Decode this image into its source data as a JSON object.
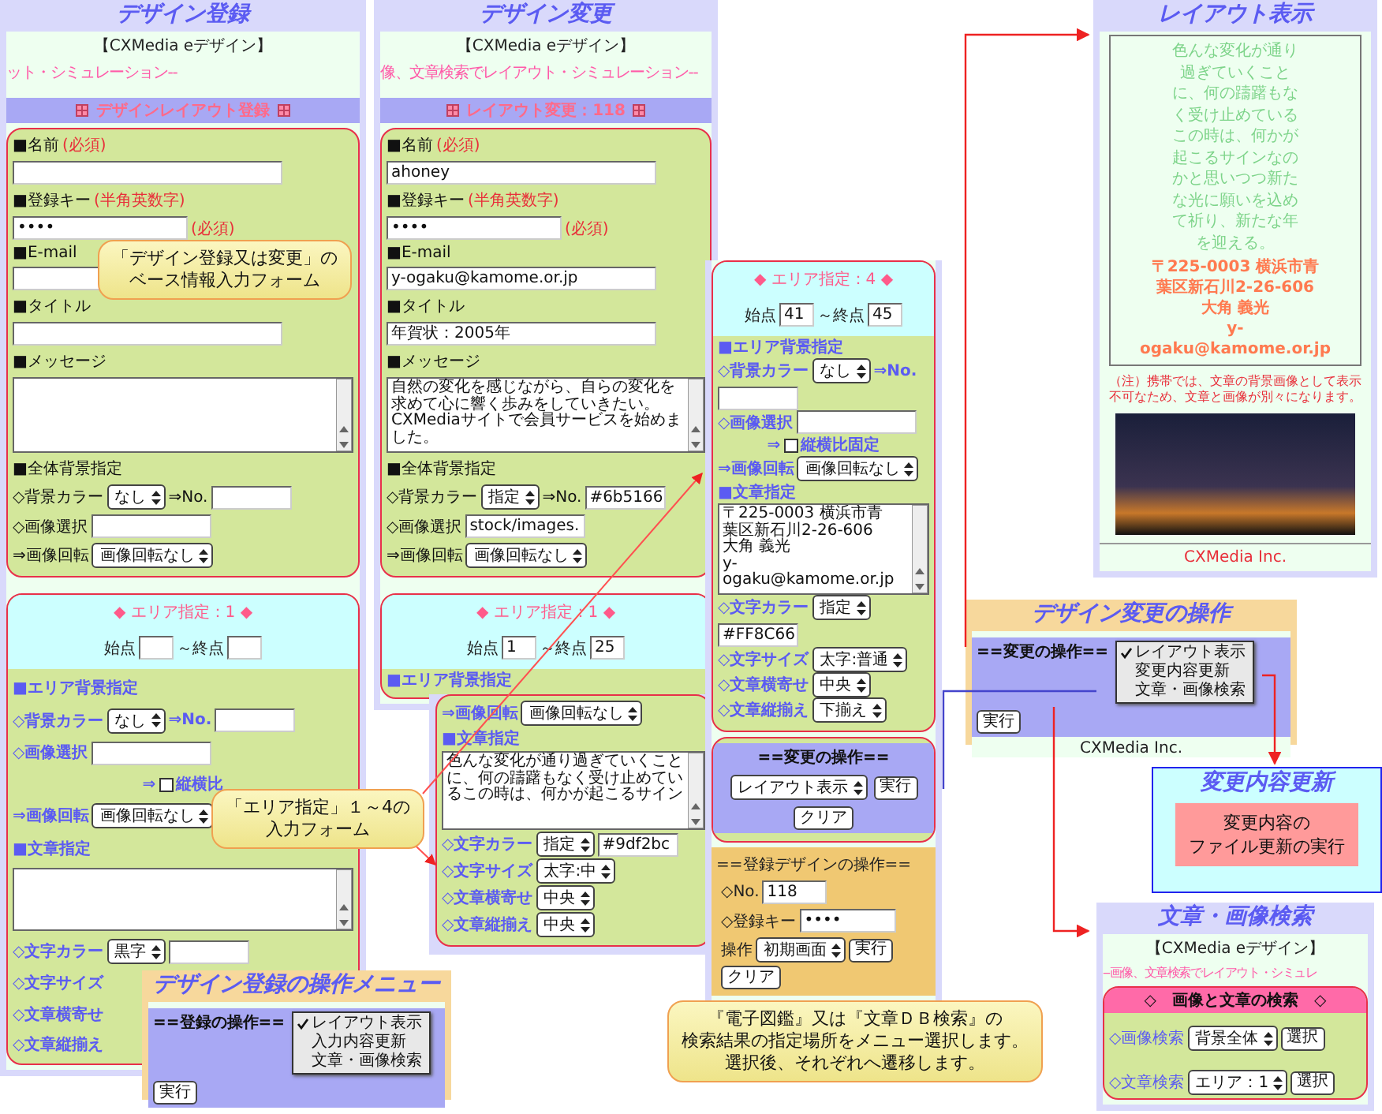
{
  "register": {
    "title": "デザイン登録",
    "brand": "【CXMedia eデザイン】",
    "marquee": "ット・シミュレーション--",
    "section": "デザインレイアウト登録",
    "base_rows": [
      {
        "kind": "heading",
        "text": "■名前",
        "note": "(必須)"
      },
      {
        "kind": "input"
      },
      {
        "kind": "heading",
        "text": "■登録キー",
        "note": "(半角英数字)"
      },
      {
        "kind": "input",
        "value": "••••",
        "note": "(必須)"
      },
      {
        "kind": "heading",
        "text": "■E-mail"
      },
      {
        "kind": "input"
      },
      {
        "kind": "heading",
        "text": "■タイトル"
      },
      {
        "kind": "input"
      },
      {
        "kind": "heading",
        "text": "■メッセージ"
      },
      {
        "kind": "textarea"
      },
      {
        "kind": "heading",
        "text": "■全体背景指定"
      },
      {
        "kind": "select",
        "label": "◇背景カラー",
        "value": "なし",
        "suffix": "⇒No.",
        "box": true
      },
      {
        "kind": "file",
        "label": "◇画像選択"
      },
      {
        "kind": "select",
        "label": "⇒画像回転",
        "value": "画像回転なし"
      }
    ],
    "area": {
      "heading": "◆ エリア指定：1 ◆",
      "start_label": "始点",
      "end_label": "～終点",
      "rows": [
        {
          "kind": "heading",
          "text": "■エリア背景指定"
        },
        {
          "kind": "select",
          "label": "◇背景カラー",
          "value": "なし",
          "suffix": "⇒No.",
          "box": true
        },
        {
          "kind": "file",
          "label": "◇画像選択"
        },
        {
          "kind": "checkbox",
          "prefix": "⇒",
          "text": "縦横比",
          "checked": false
        },
        {
          "kind": "select",
          "label": "⇒画像回転",
          "value": "画像回転なし"
        },
        {
          "kind": "heading",
          "text": "■文章指定"
        },
        {
          "kind": "textarea"
        },
        {
          "kind": "select",
          "label": "◇文字カラー",
          "value": "黒字",
          "box": true
        },
        {
          "kind": "label",
          "text": "◇文字サイズ"
        },
        {
          "kind": "label",
          "text": "◇文章横寄せ"
        },
        {
          "kind": "label",
          "text": "◇文章縦揃え"
        }
      ]
    }
  },
  "change": {
    "title": "デザイン変更",
    "brand": "【CXMedia eデザイン】",
    "marquee": "像、文章検索でレイアウト・シミュレーション--",
    "section": "レイアウト変更：118",
    "base_rows": [
      {
        "kind": "heading",
        "text": "■名前",
        "note": "(必須)"
      },
      {
        "kind": "input",
        "value": "ahoney"
      },
      {
        "kind": "heading",
        "text": "■登録キー",
        "note": "(半角英数字)"
      },
      {
        "kind": "input",
        "value": "••••",
        "note": "(必須)"
      },
      {
        "kind": "heading",
        "text": "■E-mail"
      },
      {
        "kind": "input",
        "value": "y-ogaku@kamome.or.jp"
      },
      {
        "kind": "heading",
        "text": "■タイトル"
      },
      {
        "kind": "input",
        "value": "年賀状：2005年"
      },
      {
        "kind": "heading",
        "text": "■メッセージ"
      },
      {
        "kind": "textarea",
        "lines": [
          "自然の変化を感じながら、自らの変化を求めて心に響く歩みをしていきたい。",
          "CXMediaサイトで会員サービスを始めました。"
        ]
      },
      {
        "kind": "heading",
        "text": "■全体背景指定"
      },
      {
        "kind": "select",
        "label": "◇背景カラー",
        "value": "指定",
        "suffix": "⇒No.",
        "box": true,
        "box_value": "#6b5166"
      },
      {
        "kind": "file",
        "label": "◇画像選択",
        "value": "stock/images."
      },
      {
        "kind": "select",
        "label": "⇒画像回転",
        "value": "画像回転なし"
      }
    ],
    "area": {
      "heading": "◆ エリア指定：1 ◆",
      "start_label": "始点",
      "start": "1",
      "end_label": "～終点",
      "end": "25",
      "rows": [
        {
          "kind": "heading",
          "text": "■エリア背景指定"
        }
      ]
    }
  },
  "change_area_more": {
    "rows": [
      {
        "kind": "select",
        "label": "⇒画像回転",
        "value": "画像回転なし"
      },
      {
        "kind": "heading",
        "text": "■文章指定"
      },
      {
        "kind": "textarea",
        "lines": [
          "色んな変化が通り過ぎていくことに、何の躊躇もなく受け止めているこの時は、何かが起こるサイン"
        ]
      },
      {
        "kind": "select",
        "label": "◇文字カラー",
        "value": "指定",
        "box": true,
        "box_value": "#9df2bc"
      },
      {
        "kind": "select",
        "label": "◇文字サイズ",
        "value": "太字:中"
      },
      {
        "kind": "select",
        "label": "◇文章横寄せ",
        "value": "中央"
      },
      {
        "kind": "select",
        "label": "◇文章縦揃え",
        "value": "中央"
      }
    ]
  },
  "area4": {
    "area": {
      "heading": "◆ エリア指定：4 ◆",
      "start_label": "始点",
      "start": "41",
      "end_label": "～終点",
      "end": "45",
      "rows": [
        {
          "kind": "heading",
          "text": "■エリア背景指定"
        },
        {
          "kind": "select",
          "label": "◇背景カラー",
          "value": "なし",
          "suffix": "⇒No.",
          "box": true
        },
        {
          "kind": "file",
          "label": "◇画像選択"
        },
        {
          "kind": "checkbox",
          "prefix": "⇒",
          "text": "縦横比固定",
          "checked": false
        },
        {
          "kind": "select",
          "label": "⇒画像回転",
          "value": "画像回転なし"
        },
        {
          "kind": "heading",
          "text": "■文章指定"
        },
        {
          "kind": "textarea",
          "lines": [
            "〒225-0003 横浜市青",
            "葉区新石川2-26-606",
            "大角 義光",
            "y-",
            "ogaku@kamome.or.jp"
          ]
        },
        {
          "kind": "select",
          "label": "◇文字カラー",
          "value": "指定",
          "box": true,
          "box_value": "#FF8C66"
        },
        {
          "kind": "select",
          "label": "◇文字サイズ",
          "value": "太字:普通"
        },
        {
          "kind": "select",
          "label": "◇文章横寄せ",
          "value": "中央"
        },
        {
          "kind": "select",
          "label": "◇文章縦揃え",
          "value": "下揃え"
        }
      ]
    },
    "operation": {
      "label": "==変更の操作==",
      "value": "レイアウト表示",
      "buttons": [
        "実行",
        "クリア"
      ]
    },
    "saved_design": {
      "title": "==登録デザインの操作==",
      "no_label": "◇No.",
      "no": "118",
      "key_label": "◇登録キー",
      "key": "••••",
      "op_label": "操作",
      "op_value": "初期画面",
      "buttons": [
        "実行",
        "クリア"
      ]
    }
  },
  "layout_view": {
    "title": "レイアウト表示",
    "poem_lines": [
      "色んな変化が通り",
      "過ぎていくこと",
      "に、何の躊躇もな",
      "く受け止めている",
      "この時は、何かが",
      "起こるサインなの",
      "かと思いつつ新た",
      "な光に願いを込め",
      "て祈り、新たな年",
      "を迎える。"
    ],
    "address_lines": [
      "〒225-0003 横浜市青",
      "葉区新石川2-26-606",
      "大角 義光",
      "y-",
      "ogaku@kamome.or.jp"
    ],
    "note": "（注）携帯では、文章の背景画像として表示不可なため、文章と画像が別々になります。",
    "footer": "CXMedia Inc."
  },
  "change_menu": {
    "title": "デザイン変更の操作",
    "label": "==変更の操作==",
    "options": [
      {
        "text": "レイアウト表示",
        "selected": true
      },
      {
        "text": "変更内容更新",
        "selected": false
      },
      {
        "text": "文章・画像検索",
        "selected": false
      }
    ],
    "button": "実行",
    "footer": "CXMedia Inc."
  },
  "update": {
    "title": "変更内容更新",
    "message_lines": [
      "変更内容の",
      "ファイル更新の実行"
    ]
  },
  "search": {
    "title": "文章・画像検索",
    "brand": "【CXMedia eデザイン】",
    "marquee": "--画像、文章検索でレイアウト・シミュレ",
    "heading": "◇　画像と文章の検索　◇",
    "rows": [
      {
        "label": "◇画像検索",
        "value": "背景全体",
        "button": "選択"
      },
      {
        "label": "◇文章検索",
        "value": "エリア：1",
        "button": "選択"
      }
    ]
  },
  "register_menu": {
    "title": "デザイン登録の操作メニュー",
    "label": "==登録の操作==",
    "options": [
      {
        "text": "レイアウト表示",
        "selected": true
      },
      {
        "text": "入力内容更新",
        "selected": false
      },
      {
        "text": "文章・画像検索",
        "selected": false
      }
    ],
    "button": "実行"
  },
  "callouts": [
    {
      "lines": [
        "「デザイン登録又は変更」の",
        "ベース情報入力フォーム"
      ]
    },
    {
      "lines": [
        "「エリア指定」１～4の",
        "入力フォーム"
      ]
    },
    {
      "lines": [
        "『電子図鑑』又は『文章ＤＢ検索』の",
        "検索結果の指定場所をメニュー選択します。",
        "選択後、それぞれへ遷移します。"
      ]
    }
  ]
}
